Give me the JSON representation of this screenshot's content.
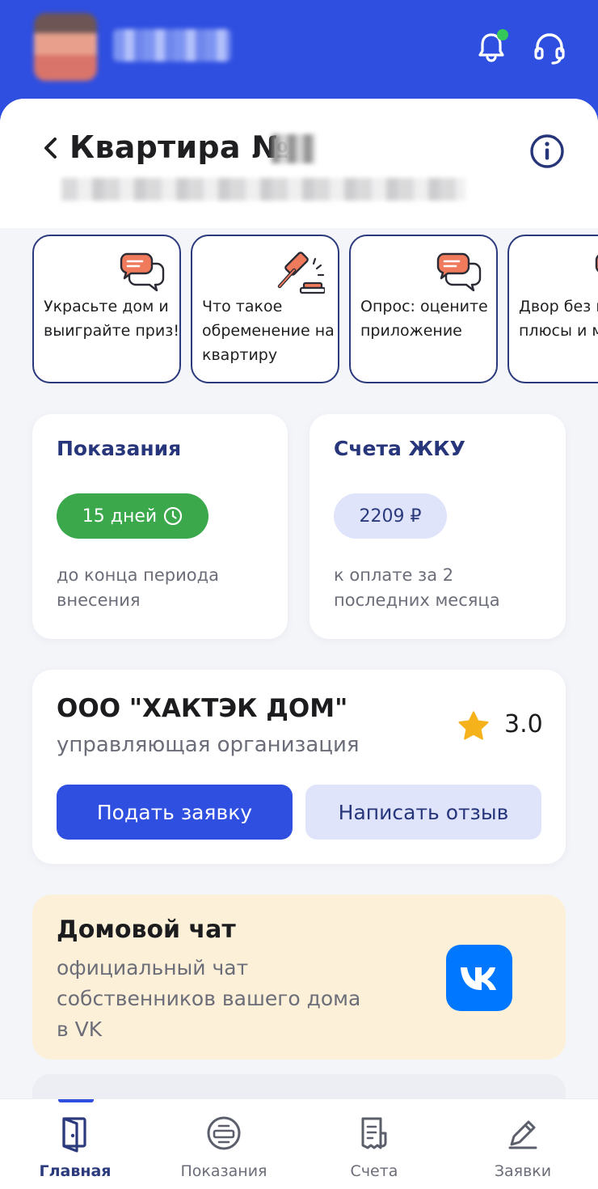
{
  "header": {
    "avatar_alt": "avatar",
    "bell_icon": "bell-icon",
    "support_icon": "headset-icon"
  },
  "page": {
    "title": "Квартира №"
  },
  "stories": [
    {
      "icon": "chat-bubbles-icon",
      "text": "Украсьте дом и выиграйте приз!"
    },
    {
      "icon": "gavel-icon",
      "text": "Что такое обременение на квартиру"
    },
    {
      "icon": "chat-bubbles-icon",
      "text": "Опрос: оцените приложение"
    },
    {
      "icon": "chat-bubbles-icon",
      "text": "Двор без машин: плюсы и минусы"
    }
  ],
  "readings_card": {
    "title": "Показания",
    "pill": "15 дней",
    "subtitle": "до конца периода внесения"
  },
  "bills_card": {
    "title": "Счета ЖКУ",
    "pill": "2209 ₽",
    "subtitle": "к оплате за 2 последних месяца"
  },
  "org_card": {
    "name": "ООО \"ХАКТЭК ДОМ\"",
    "role": "управляющая организация",
    "rating": "3.0",
    "primary_button": "Подать заявку",
    "secondary_button": "Написать отзыв"
  },
  "chat_card": {
    "title": "Домовой чат",
    "subtitle": "официальный чат собственников вашего дома в VK"
  },
  "tabbar": {
    "active": 0,
    "items": [
      {
        "label": "Главная",
        "icon": "door-icon"
      },
      {
        "label": "Показания",
        "icon": "meter-icon"
      },
      {
        "label": "Счета",
        "icon": "receipt-icon"
      },
      {
        "label": "Заявки",
        "icon": "pencil-icon"
      }
    ]
  },
  "colors": {
    "brand_blue": "#2F4FE0",
    "dark_blue": "#27357a",
    "green": "#3aa84b",
    "chat_bg": "#fcf0d9",
    "vk_blue": "#0077ff",
    "star": "#f5b21b"
  }
}
